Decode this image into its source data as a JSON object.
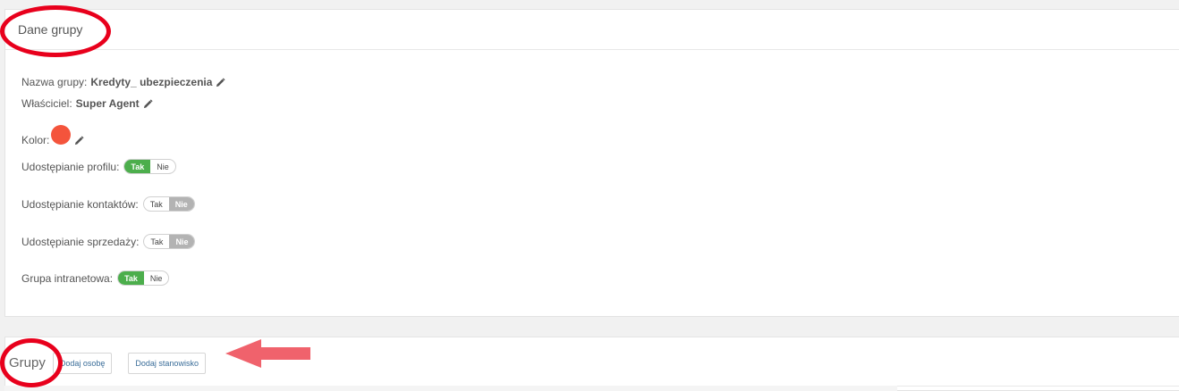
{
  "dane_panel": {
    "title": "Dane grupy",
    "group_name": {
      "label": "Nazwa grupy:",
      "value": "Kredyty_ ubezpieczenia"
    },
    "owner": {
      "label": "Właściciel:",
      "value": "Super Agent"
    },
    "color": {
      "label": "Kolor:",
      "value": "#f4543c"
    },
    "toggles": [
      {
        "label": "Udostępianie profilu:",
        "yes": "Tak",
        "no": "Nie",
        "selected": "Tak"
      },
      {
        "label": "Udostępianie kontaktów:",
        "yes": "Tak",
        "no": "Nie",
        "selected": "Nie"
      },
      {
        "label": "Udostępianie sprzedaży:",
        "yes": "Tak",
        "no": "Nie",
        "selected": "Nie"
      },
      {
        "label": "Grupa intranetowa:",
        "yes": "Tak",
        "no": "Nie",
        "selected": "Tak"
      }
    ]
  },
  "grupy_panel": {
    "title": "Grupy",
    "add_person_label": "Dodaj osobę",
    "add_position_label": "Dodaj stanowisko"
  },
  "colors": {
    "accent_green": "#4cae4c",
    "inactive_grey": "#b3b3b3",
    "annotation_red": "#e8001c"
  },
  "icons": [
    "pencil-icon"
  ]
}
